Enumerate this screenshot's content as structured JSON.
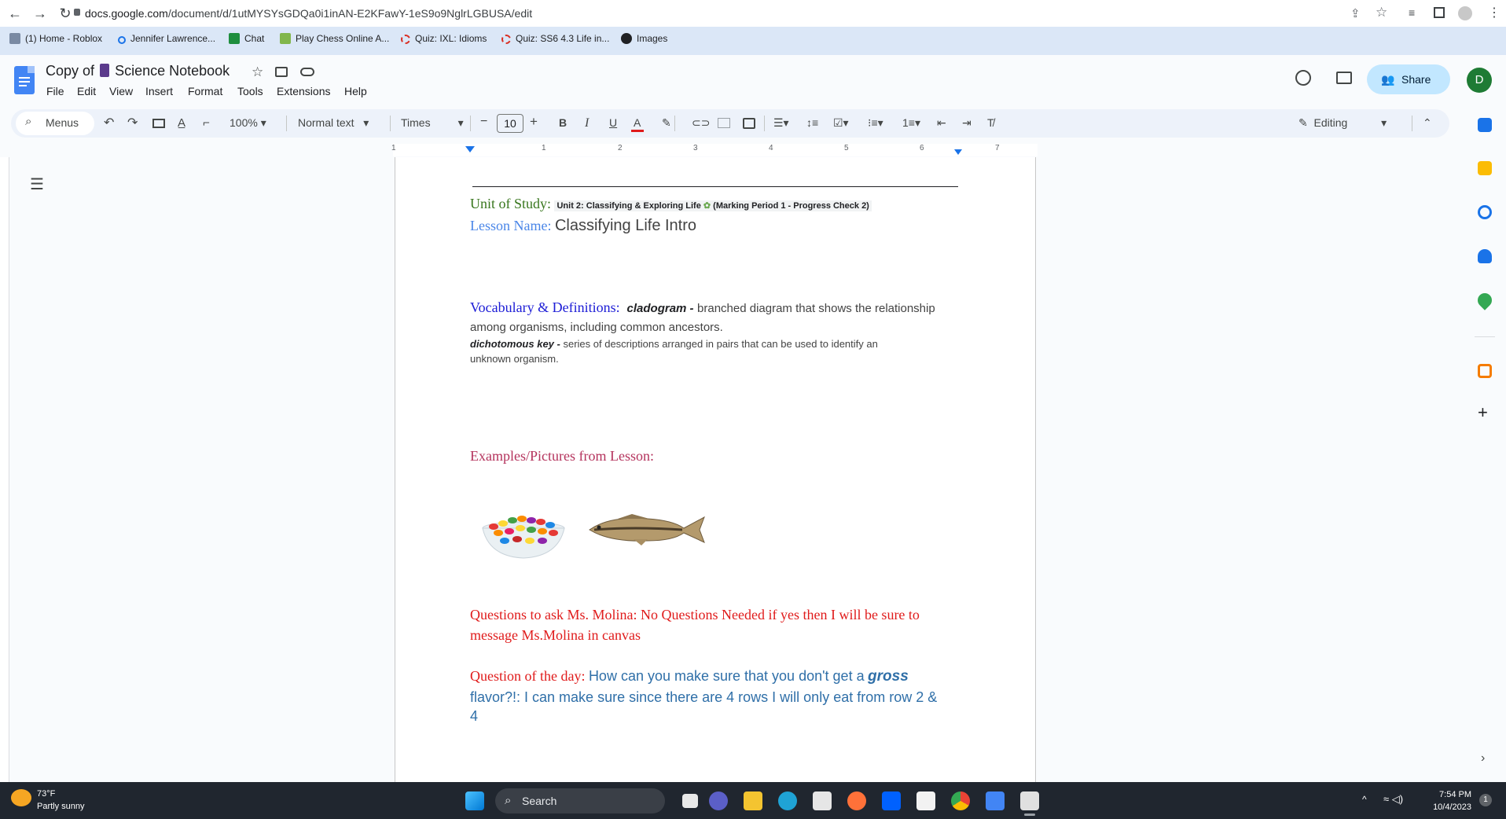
{
  "browser": {
    "url_host": "docs.google.com",
    "url_path": "/document/d/1utMYSYsGDQa0i1inAN-E2KFawY-1eS9o9NglrLGBUSA/edit",
    "bookmarks": [
      "(1) Home - Roblox",
      "Jennifer Lawrence...",
      "Chat",
      "Play Chess Online A...",
      "Quiz: IXL: Idioms",
      "Quiz: SS6 4.3 Life in...",
      "Images"
    ]
  },
  "docs": {
    "title_prefix": "Copy of",
    "title_main": "Science Notebook",
    "menu": [
      "File",
      "Edit",
      "View",
      "Insert",
      "Format",
      "Tools",
      "Extensions",
      "Help"
    ],
    "share_label": "Share",
    "avatar_initial": "D",
    "toolbar": {
      "menus_label": "Menus",
      "zoom": "100%",
      "style": "Normal text",
      "font": "Times",
      "font_size": "10",
      "editing_label": "Editing"
    },
    "ruler_numbers": [
      "1",
      "1",
      "2",
      "3",
      "4",
      "5",
      "6",
      "7"
    ]
  },
  "content": {
    "unit_label": "Unit of Study:",
    "unit_value": "Unit 2: Classifying & Exploring Life",
    "unit_suffix": "(Marking Period 1 - Progress Check 2)",
    "lesson_label": "Lesson Name:",
    "lesson_value": "Classifying Life Intro",
    "vocab_label": "Vocabulary & Definitions:",
    "vocab_term1": "cladogram -",
    "vocab_def1_a": "branched diagram that shows the relationship",
    "vocab_def1_b": "among organisms, including common ancestors.",
    "vocab_term2": "dichotomous key -",
    "vocab_def2_a": "series of descriptions arranged in pairs that can be used to identify an",
    "vocab_def2_b": "unknown organism.",
    "examples_label": "Examples/Pictures from Lesson:",
    "questions_line1": "Questions to ask Ms. Molina: No Questions Needed if yes then I will be sure to",
    "questions_line2": "message Ms.Molina in canvas",
    "qotd_label": "Question of the day:",
    "qotd_text_a": "How can you make sure that you don't get a",
    "qotd_bold": "gross",
    "qotd_text_b": "flavor?!: I can make sure since there are 4 rows I will only eat from row 2 &",
    "qotd_text_c": "4"
  },
  "taskbar": {
    "temp": "73°F",
    "weather": "Partly sunny",
    "search": "Search",
    "time": "7:54 PM",
    "date": "10/4/2023",
    "notif": "1"
  },
  "colors": {
    "unit_label": "#38761d",
    "lesson_label": "#4a86e8",
    "vocab_label": "#1c1cd6",
    "examples_label": "#b4325c",
    "questions": "#e01b1b",
    "qotd_text": "#2f6fa8"
  }
}
